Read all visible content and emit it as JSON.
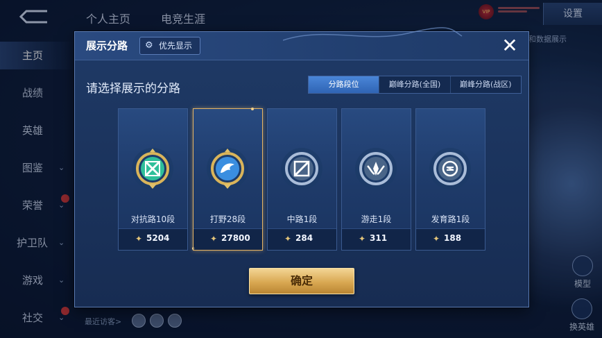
{
  "background": {
    "top_tabs": [
      "个人主页",
      "电竞生涯"
    ],
    "settings_label": "设置",
    "sidebar": [
      "主页",
      "战绩",
      "英雄",
      "图鉴",
      "荣誉",
      "护卫队",
      "游戏",
      "社交"
    ],
    "recent_visitors_label": "最近访客>",
    "right_buttons": [
      "模型",
      "换英雄"
    ],
    "peek_text": "和数据展示"
  },
  "dialog": {
    "title": "展示分路",
    "priority_label": "优先显示",
    "select_title": "请选择展示的分路",
    "segments": [
      {
        "label": "分路段位",
        "active": true
      },
      {
        "label": "巅峰分路(全国)",
        "active": false
      },
      {
        "label": "巅峰分路(战区)",
        "active": false
      }
    ],
    "cards": [
      {
        "position": "对抗路10段",
        "score": "5204",
        "selected": false,
        "accent": "#2fbf9a"
      },
      {
        "position": "打野28段",
        "score": "27800",
        "selected": true,
        "accent": "#3a8ee0"
      },
      {
        "position": "中路1段",
        "score": "284",
        "selected": false,
        "accent": "#9fb4d6"
      },
      {
        "position": "游走1段",
        "score": "311",
        "selected": false,
        "accent": "#9fb4d6"
      },
      {
        "position": "发育路1段",
        "score": "188",
        "selected": false,
        "accent": "#9fb4d6"
      }
    ],
    "confirm_label": "确定"
  },
  "colors": {
    "gold": "#d9a852",
    "selected_border": "#e7b564",
    "segment_active": "#3a74c6"
  }
}
